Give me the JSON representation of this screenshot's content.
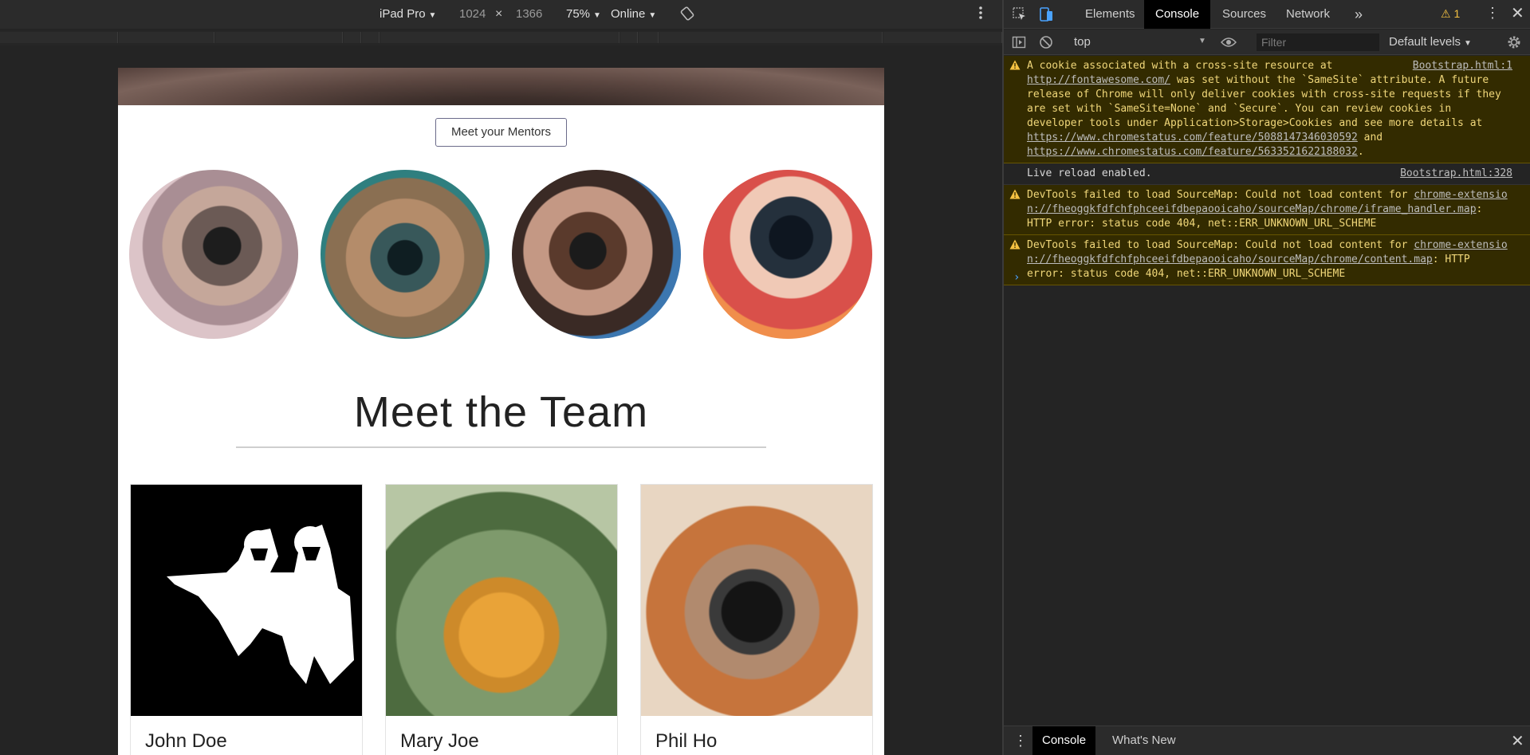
{
  "device_toolbar": {
    "device": "iPad Pro",
    "width": "1024",
    "times": "×",
    "height": "1366",
    "zoom": "75%",
    "network": "Online"
  },
  "page": {
    "mentors_button": "Meet your Mentors",
    "team_title": "Meet the Team",
    "team": [
      {
        "name": "John Doe"
      },
      {
        "name": "Mary Joe"
      },
      {
        "name": "Phil Ho"
      }
    ]
  },
  "devtools": {
    "tabs": [
      "Elements",
      "Console",
      "Sources",
      "Network"
    ],
    "more_tabs": "»",
    "warning_count": "1",
    "context": "top",
    "filter_placeholder": "Filter",
    "levels": "Default levels",
    "messages": [
      {
        "type": "warning",
        "text_1": "A cookie associated with a cross-site resource at ",
        "link_1": "http://fontawesome.com/",
        "text_2": " was set without the `SameSite` attribute. A future release of Chrome will only deliver cookies with cross-site requests if they are set with `SameSite=None` and `Secure`. You can review cookies in developer tools under Application>Storage>Cookies and see more details at ",
        "link_2": "https://www.chromestatus.com/feature/5088147346030592",
        "text_3": " and ",
        "link_3": "https://www.chromestatus.com/feature/5633521622188032",
        "text_4": ".",
        "source": "Bootstrap.html:1"
      },
      {
        "type": "log",
        "text": "Live reload enabled.",
        "source": "Bootstrap.html:328"
      },
      {
        "type": "warning",
        "text_1": "DevTools failed to load SourceMap: Could not load content for ",
        "link_1": "chrome-extension://fheoggkfdfchfphceeifdbepaooicaho/sourceMap/chrome/iframe_handler.map",
        "text_2": ": HTTP error: status code 404, net::ERR_UNKNOWN_URL_SCHEME"
      },
      {
        "type": "warning",
        "text_1": "DevTools failed to load SourceMap: Could not load content for ",
        "link_1": "chrome-extension://fheoggkfdfchfphceeifdbepaooicaho/sourceMap/chrome/content.map",
        "text_2": ": HTTP error: status code 404, net::ERR_UNKNOWN_URL_SCHEME"
      }
    ],
    "prompt": "›",
    "drawer_tabs": [
      "Console",
      "What's New"
    ]
  },
  "colors": {
    "warning_bg": "#332b00",
    "warning_text": "#f0d77a",
    "accent": "#4aa3ff"
  }
}
